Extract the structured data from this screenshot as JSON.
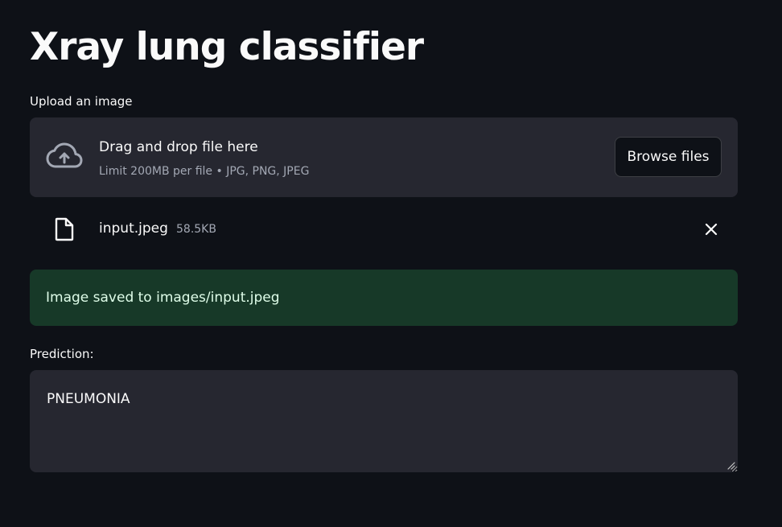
{
  "page": {
    "title": "Xray lung classifier"
  },
  "uploader": {
    "label": "Upload an image",
    "dropzone_title": "Drag and drop file here",
    "dropzone_subtitle": "Limit 200MB per file • JPG, PNG, JPEG",
    "browse_label": "Browse files",
    "icon": "cloud-upload-icon"
  },
  "uploaded_file": {
    "name": "input.jpeg",
    "size": "58.5KB",
    "icon": "file-icon",
    "remove_icon": "close-icon"
  },
  "status": {
    "message": "Image saved to images/input.jpeg"
  },
  "prediction": {
    "label": "Prediction:",
    "value": "PNEUMONIA"
  },
  "colors": {
    "background": "#0e1117",
    "widget_background": "#262730",
    "success_background": "#173928",
    "success_text": "#dffde9",
    "text": "#fafafa",
    "muted_text": "#a3a8b4"
  }
}
